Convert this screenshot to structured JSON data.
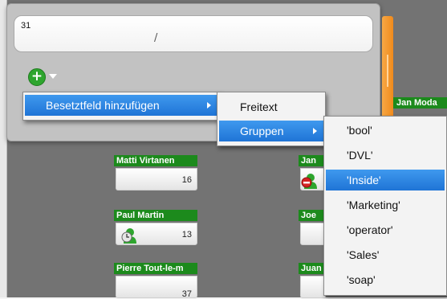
{
  "panel": {
    "input_value": "31",
    "input_mark": "/"
  },
  "context_menu": {
    "item": "Besetztfeld hinzufügen"
  },
  "submenu": {
    "items": [
      "Freitext",
      "Gruppen"
    ]
  },
  "groups_menu": {
    "items": [
      "'bool'",
      "'DVL'",
      "'Inside'",
      "'Marketing'",
      "'operator'",
      "'Sales'",
      "'soap'"
    ],
    "selected": "'Inside'"
  },
  "cards": {
    "matti": {
      "name": "Matti Virtanen",
      "count": "16"
    },
    "paul": {
      "name": "Paul Martin",
      "count": "13"
    },
    "pierre": {
      "name": "Pierre Tout-le-m",
      "count": "37"
    },
    "jan": {
      "name": "Jan"
    },
    "joe": {
      "name": "Joe"
    },
    "juan": {
      "name": "Juan"
    },
    "jan_moda": {
      "name": "Jan Moda"
    }
  },
  "colors": {
    "card_header": "#1c8a1c",
    "selection": "#2a82e0",
    "scrollbar": "#f08a1c",
    "board": "#737373"
  },
  "icons": {
    "add": "plus-circle-icon",
    "clock": "clock-icon",
    "busy": "no-entry-icon"
  }
}
